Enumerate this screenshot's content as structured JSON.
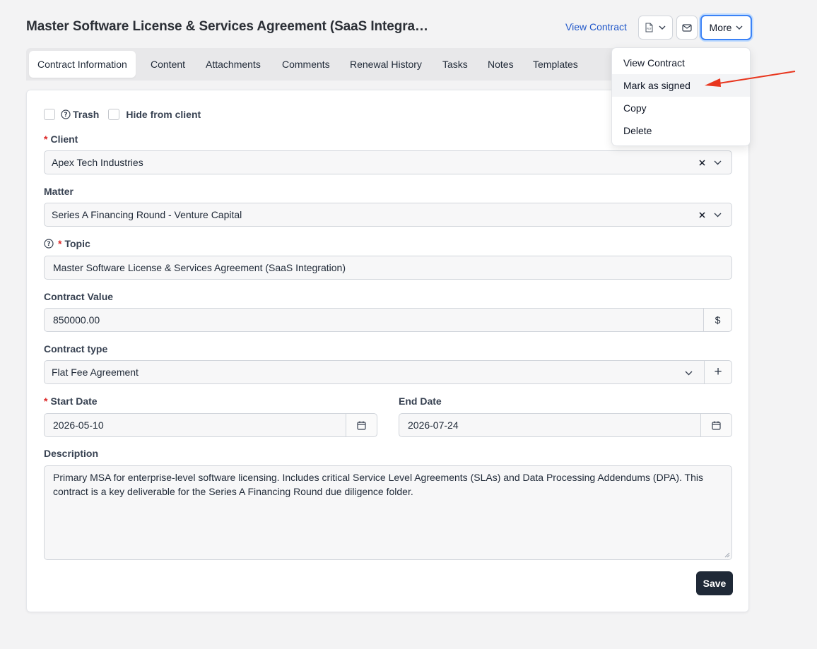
{
  "header": {
    "title": "Master Software License & Services Agreement (SaaS Integrati…",
    "view_contract_link": "View Contract",
    "more_label": "More"
  },
  "tabs": [
    {
      "label": "Contract Information",
      "active": true
    },
    {
      "label": "Content"
    },
    {
      "label": "Attachments"
    },
    {
      "label": "Comments"
    },
    {
      "label": "Renewal History"
    },
    {
      "label": "Tasks"
    },
    {
      "label": "Notes"
    },
    {
      "label": "Templates"
    }
  ],
  "more_menu": {
    "items": [
      "View Contract",
      "Mark as signed",
      "Copy",
      "Delete"
    ],
    "highlighted": "Mark as signed"
  },
  "form": {
    "trash_label": "Trash",
    "hide_from_client_label": "Hide from client",
    "client": {
      "label": "Client",
      "required": "*",
      "value": "Apex Tech Industries"
    },
    "matter": {
      "label": "Matter",
      "value": "Series A Financing Round - Venture Capital"
    },
    "topic": {
      "label": "Topic",
      "required": "*",
      "value": "Master Software License & Services Agreement (SaaS Integration)"
    },
    "contract_value": {
      "label": "Contract Value",
      "value": "850000.00",
      "currency": "$"
    },
    "contract_type": {
      "label": "Contract type",
      "value": "Flat Fee Agreement",
      "add": "+"
    },
    "start_date": {
      "label": "Start Date",
      "required": "*",
      "value": "2026-05-10"
    },
    "end_date": {
      "label": "End Date",
      "value": "2026-07-24"
    },
    "description": {
      "label": "Description",
      "value": "Primary MSA for enterprise-level software licensing. Includes critical Service Level Agreements (SLAs) and Data Processing Addendums (DPA). This contract is a key deliverable for the Series A Financing Round due diligence folder."
    },
    "save_label": "Save"
  },
  "colors": {
    "link": "#2057c9",
    "required": "#dc2626",
    "save_button": "#1f2937",
    "focus_ring": "#3b82f6",
    "annotation_arrow": "#e8361e"
  },
  "icons": {
    "pdf": "pdf-file-icon",
    "mail": "envelope-icon",
    "chevron": "chevron-down-icon",
    "clear": "close-icon",
    "calendar": "calendar-icon",
    "help": "question-circle-icon"
  }
}
